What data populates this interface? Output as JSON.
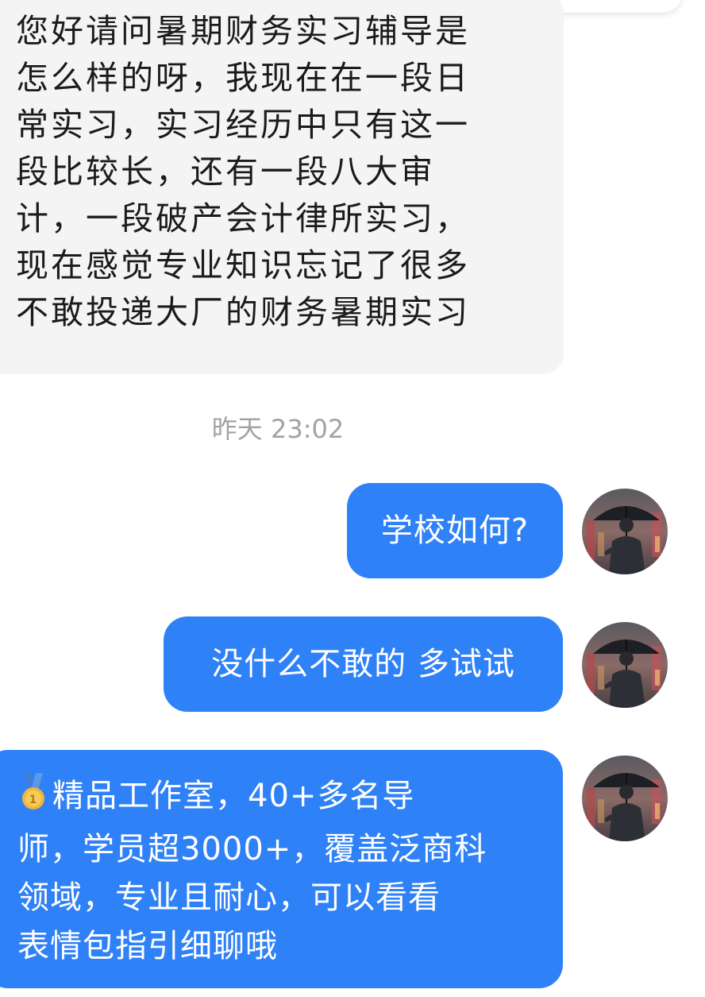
{
  "messages": [
    {
      "direction": "incoming",
      "text": "您好请问暑期财务实习辅导是\n怎么样的呀，我现在在一段日\n常实习，实习经历中只有这一\n段比较长，还有一段八大审\n计，一段破产会计律所实习，\n现在感觉专业知识忘记了很多\n不敢投递大厂的财务暑期实习"
    },
    {
      "direction": "outgoing",
      "text": "学校如何?"
    },
    {
      "direction": "outgoing",
      "text": "没什么不敢的 多试试"
    },
    {
      "direction": "outgoing",
      "emoji_icon": "medal-icon",
      "text": "精品工作室，40+多名导\n师，学员超3000+，覆盖泛商科\n领域，专业且耐心，可以看看\n表情包指引细聊哦"
    }
  ],
  "timestamp": "昨天 23:02",
  "colors": {
    "outgoing_bubble": "#2f81f7",
    "incoming_bubble": "#f4f4f4",
    "timestamp_text": "#a2a2a2"
  },
  "avatar_icon": "avatar-umbrella-man"
}
